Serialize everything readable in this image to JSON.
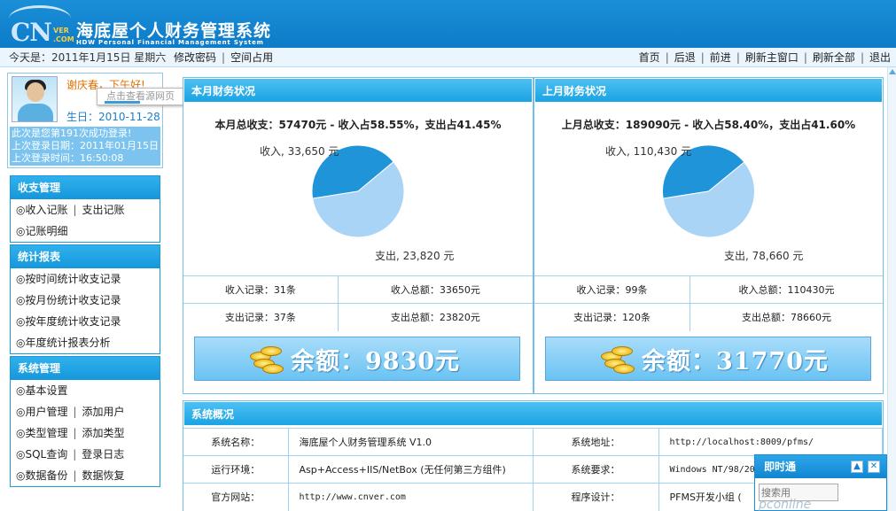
{
  "header": {
    "logo_cn": "CN",
    "logo_ver": "VER",
    "logo_com": ".COM",
    "title": "海底屋个人财务管理系统",
    "subtitle": "HDW Personal Financial Management System"
  },
  "topbar": {
    "today": "今天是：2011年1月15日  星期六",
    "change_password": "修改密码",
    "space_usage": "空间占用",
    "nav": [
      "首页",
      "后退",
      "前进",
      "刷新主窗口",
      "刷新全部",
      "退出"
    ]
  },
  "user": {
    "greeting": "谢庆春，下午好!",
    "tooltip": "点击查看源网页",
    "birthday": "生日：2010-11-28",
    "login_count": "此次是您第191次成功登录!",
    "last_login_date": "上次登录日期：2011年01月15日",
    "last_login_time": "上次登录时间：16:50:08"
  },
  "menus": [
    {
      "title": "收支管理",
      "rows": [
        [
          "◎收入记账",
          "支出记账"
        ],
        [
          "◎记账明细"
        ]
      ]
    },
    {
      "title": "统计报表",
      "rows": [
        [
          "◎按时间统计收支记录"
        ],
        [
          "◎按月份统计收支记录"
        ],
        [
          "◎按年度统计收支记录"
        ],
        [
          "◎年度统计报表分析"
        ]
      ]
    },
    {
      "title": "系统管理",
      "rows": [
        [
          "◎基本设置"
        ],
        [
          "◎用户管理",
          "添加用户"
        ],
        [
          "◎类型管理",
          "添加类型"
        ],
        [
          "◎SQL查询",
          "登录日志"
        ],
        [
          "◎数据备份",
          "数据恢复"
        ]
      ]
    }
  ],
  "this_month": {
    "head": "本月财务状况",
    "summary": "本月总收支：57470元 - 收入占58.55%，支出占41.45%",
    "income_label": "收入, 33,650 元",
    "expense_label": "支出, 23,820 元",
    "income_records": "收入记录：31条",
    "income_total": "收入总额：33650元",
    "expense_records": "支出记录：37条",
    "expense_total": "支出总额：23820元",
    "balance": "余额：9830元"
  },
  "last_month": {
    "head": "上月财务状况",
    "summary": "上月总收支：189090元 - 收入占58.40%，支出占41.60%",
    "income_label": "收入, 110,430 元",
    "expense_label": "支出, 78,660 元",
    "income_records": "收入记录：99条",
    "income_total": "收入总额：110430元",
    "expense_records": "支出记录：120条",
    "expense_total": "支出总额：78660元",
    "balance": "余额：31770元"
  },
  "system": {
    "head": "系统概况",
    "rows": [
      {
        "k1": "系统名称：",
        "v1": "海底屋个人财务管理系统 V1.0",
        "k2": "系统地址：",
        "v2": "http://localhost:8009/pfms/"
      },
      {
        "k1": "运行环境：",
        "v1": "Asp+Access+IIS/NetBox (无任何第三方组件)",
        "k2": "系统要求：",
        "v2": "Windows NT/98/20"
      },
      {
        "k1": "官方网站：",
        "v1": "http://www.cnver.com",
        "k2": "程序设计：",
        "v2": "PFMS开发小组 ("
      }
    ]
  },
  "im": {
    "title": "即时通",
    "search_placeholder": "搜索用",
    "watermark": "pconline"
  },
  "colors": {
    "income": "#a9d4f5",
    "expense": "#1f94d8"
  },
  "chart_data": [
    {
      "type": "pie",
      "title": "本月财务状况",
      "categories": [
        "收入",
        "支出"
      ],
      "values": [
        33650,
        23820
      ]
    },
    {
      "type": "pie",
      "title": "上月财务状况",
      "categories": [
        "收入",
        "支出"
      ],
      "values": [
        110430,
        78660
      ]
    }
  ]
}
